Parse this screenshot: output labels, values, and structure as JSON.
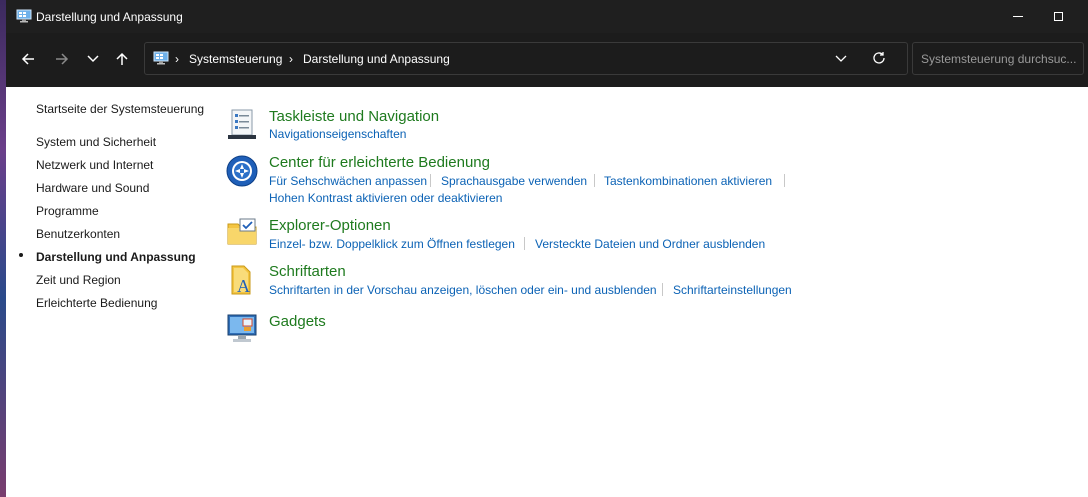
{
  "window": {
    "title": "Darstellung und Anpassung"
  },
  "navbar": {
    "breadcrumb": [
      "Systemsteuerung",
      "Darstellung und Anpassung"
    ],
    "search_placeholder": "Systemsteuerung durchsuc..."
  },
  "sidebar": {
    "home": "Startseite der Systemsteuerung",
    "items": [
      "System und Sicherheit",
      "Netzwerk und Internet",
      "Hardware und Sound",
      "Programme",
      "Benutzerkonten",
      "Darstellung und Anpassung",
      "Zeit und Region",
      "Erleichterte Bedienung"
    ],
    "active": "Darstellung und Anpassung"
  },
  "categories": [
    {
      "title": "Taskleiste und Navigation",
      "icon": "taskbar-icon",
      "links": [
        "Navigationseigenschaften"
      ]
    },
    {
      "title": "Center für erleichterte Bedienung",
      "icon": "ease-of-access-icon",
      "links": [
        "Für Sehschwächen anpassen",
        "Sprachausgabe verwenden",
        "Tastenkombinationen aktivieren",
        "Hohen Kontrast aktivieren oder deaktivieren"
      ]
    },
    {
      "title": "Explorer-Optionen",
      "icon": "folder-options-icon",
      "links": [
        "Einzel- bzw. Doppelklick zum Öffnen festlegen",
        "Versteckte Dateien und Ordner ausblenden"
      ]
    },
    {
      "title": "Schriftarten",
      "icon": "fonts-icon",
      "links": [
        "Schriftarten in der Vorschau anzeigen, löschen oder ein- und ausblenden",
        "Schriftarteinstellungen"
      ]
    },
    {
      "title": "Gadgets",
      "icon": "gadgets-icon",
      "links": []
    }
  ],
  "colors": {
    "category_title": "#1e7a1e",
    "link": "#0b62b5",
    "titlebar": "#1f1f1f"
  }
}
